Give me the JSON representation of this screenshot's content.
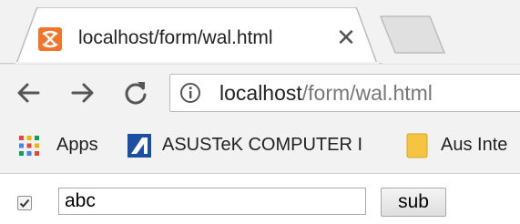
{
  "tab": {
    "title": "localhost/form/wal.html",
    "close_glyph": "✕",
    "favicon": "xampp-icon"
  },
  "toolbar": {
    "back_icon": "back-arrow-icon",
    "forward_icon": "forward-arrow-icon",
    "reload_icon": "reload-icon",
    "info_icon": "info-icon",
    "url_host": "localhost",
    "url_path": "/form/wal.html"
  },
  "bookmarks": [
    {
      "label": "Apps",
      "icon": "apps-grid-icon"
    },
    {
      "label": "ASUSTeK COMPUTER I",
      "icon": "asus-icon"
    },
    {
      "label": "Aus Inte",
      "icon": "folder-icon"
    }
  ],
  "form": {
    "checkbox_checked": true,
    "text_value": "abc",
    "submit_label": "sub"
  },
  "colors": {
    "chrome_bg": "#f2f2f2",
    "favicon_orange": "#f4742a",
    "asus_blue": "#1a4fa3",
    "folder_yellow": "#f5c542"
  }
}
